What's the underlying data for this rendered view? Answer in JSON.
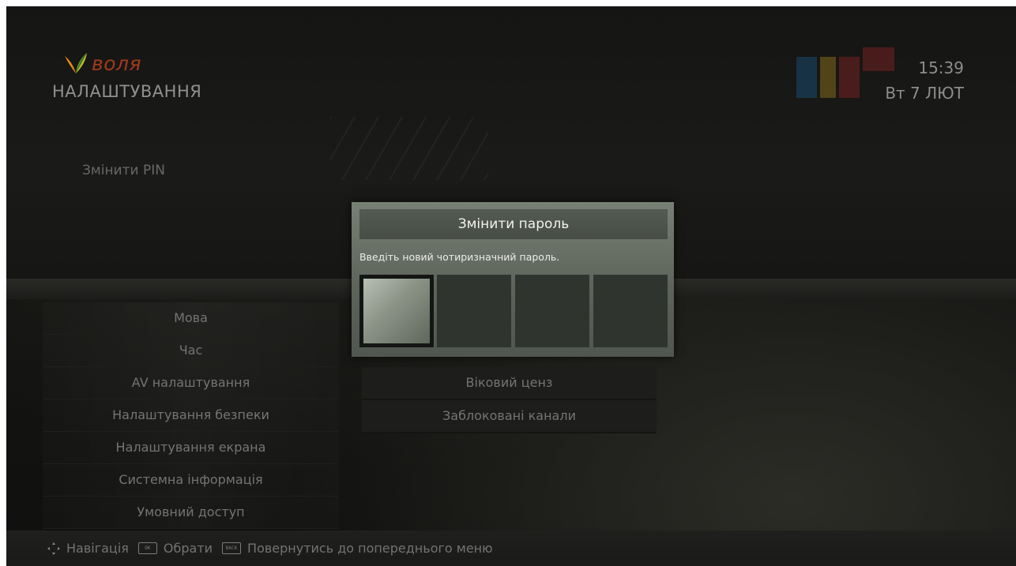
{
  "brand": {
    "logo_text": "воля"
  },
  "header": {
    "title": "НАЛАШТУВАННЯ",
    "time": "15:39",
    "date": "Вт 7 ЛЮТ"
  },
  "section": {
    "label": "Змінити PIN"
  },
  "menu": {
    "items": [
      {
        "label": "Мова"
      },
      {
        "label": "Час"
      },
      {
        "label": "AV налаштування"
      },
      {
        "label": "Налаштування безпеки"
      },
      {
        "label": "Налаштування екрана"
      },
      {
        "label": "Системна інформація"
      },
      {
        "label": "Умовний доступ"
      }
    ]
  },
  "submenu": {
    "items": [
      {
        "label": "Віковий ценз"
      },
      {
        "label": "Заблоковані канали"
      }
    ]
  },
  "dialog": {
    "title": "Змінити пароль",
    "hint": "Введіть новий чотиризначний пароль.",
    "pin_boxes": 4,
    "active_index": 0
  },
  "footer": {
    "nav_label": "Навігація",
    "ok_key": "OK",
    "select_label": "Обрати",
    "back_key": "BACK",
    "back_label": "Повернутись до попереднього меню"
  },
  "colors": {
    "logo_red": "#a23a1c",
    "logo_orange": "#e08b1c",
    "dialog_bg": "#6a7167"
  }
}
